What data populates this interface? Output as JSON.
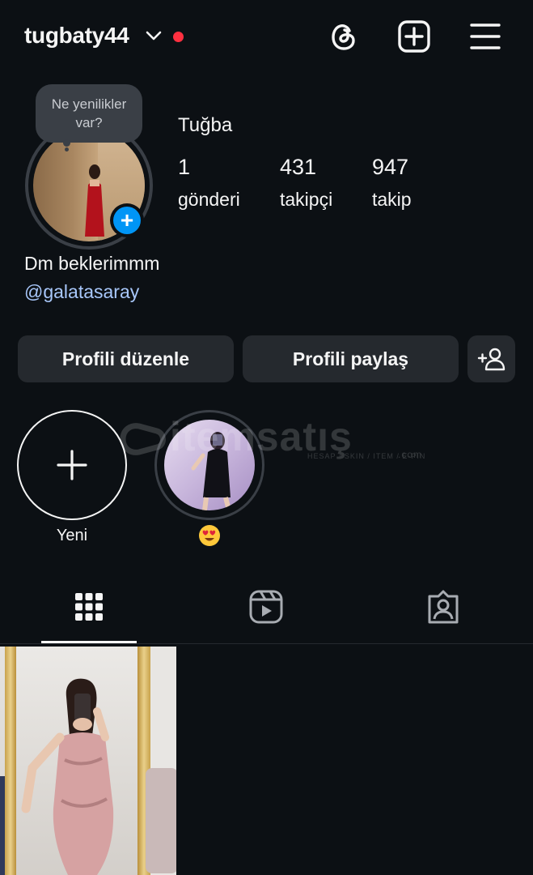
{
  "header": {
    "username": "tugbaty44",
    "icons": [
      "chevron-down-icon",
      "threads-icon",
      "create-post-icon",
      "menu-icon"
    ],
    "notification_dot_color": "#ff3040"
  },
  "profile": {
    "note": "Ne yenilikler var?",
    "full_name": "Tuğba",
    "stats": [
      {
        "value": "1",
        "label": "gönderi"
      },
      {
        "value": "431",
        "label": "takipçi"
      },
      {
        "value": "947",
        "label": "takip"
      }
    ],
    "bio": "Dm beklerimmm",
    "mention": "@galatasaray",
    "accent_color": "#0095f6",
    "mention_color": "#a8c7fa"
  },
  "actions": {
    "edit_profile": "Profili düzenle",
    "share_profile": "Profili paylaş",
    "discover_people_icon": "add-person-icon"
  },
  "highlights": [
    {
      "label": "Yeni",
      "type": "new"
    },
    {
      "label": "😍",
      "type": "story"
    }
  ],
  "watermark": {
    "brand": "itemsatış",
    "tagline": "HESAP / SKIN / ITEM / E-PIN",
    "domain": ".com"
  },
  "tabs": [
    {
      "name": "posts-grid-icon",
      "active": true
    },
    {
      "name": "reels-icon",
      "active": false
    },
    {
      "name": "tagged-icon",
      "active": false
    }
  ],
  "posts": [
    {
      "type": "photo",
      "subject": "mirror selfie"
    }
  ]
}
